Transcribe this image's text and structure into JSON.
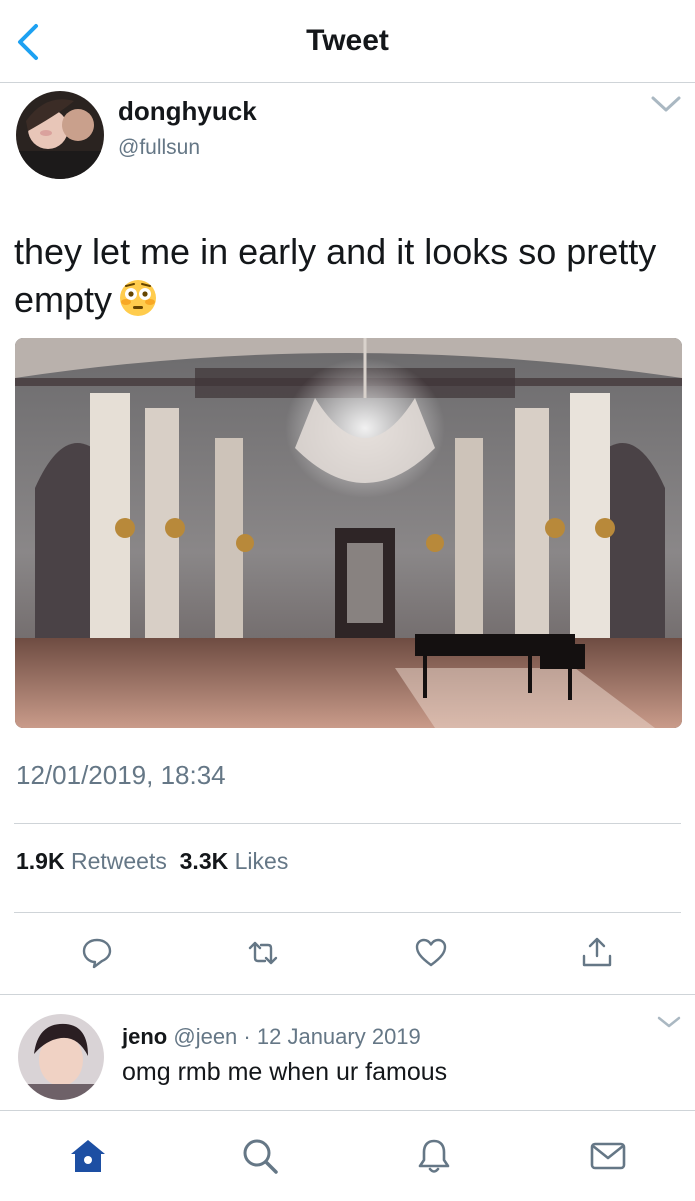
{
  "header": {
    "title": "Tweet",
    "back_icon": "chevron-left-icon"
  },
  "tweet": {
    "author_name": "donghyuck",
    "author_handle": "@fullsun",
    "text": "they let me in early and it looks so pretty empty",
    "emoji": "flushed-face-emoji",
    "timestamp": "12/01/2019, 18:34",
    "retweets_count": "1.9K",
    "retweets_label": "Retweets",
    "likes_count": "3.3K",
    "likes_label": "Likes",
    "actions": [
      "reply-icon",
      "retweet-icon",
      "like-icon",
      "share-icon"
    ]
  },
  "reply": {
    "author_name": "jeno",
    "author_handle": "@jeen",
    "separator": "·",
    "date": "12 January 2019",
    "text": "omg rmb me when ur famous"
  },
  "tabbar": {
    "items": [
      "home-icon",
      "search-icon",
      "notifications-icon",
      "messages-icon"
    ]
  },
  "colors": {
    "accent": "#1da1f2",
    "text": "#14171a",
    "secondary": "#657786",
    "divider": "#cfd4d8",
    "active_tab": "#1d4fa3"
  }
}
